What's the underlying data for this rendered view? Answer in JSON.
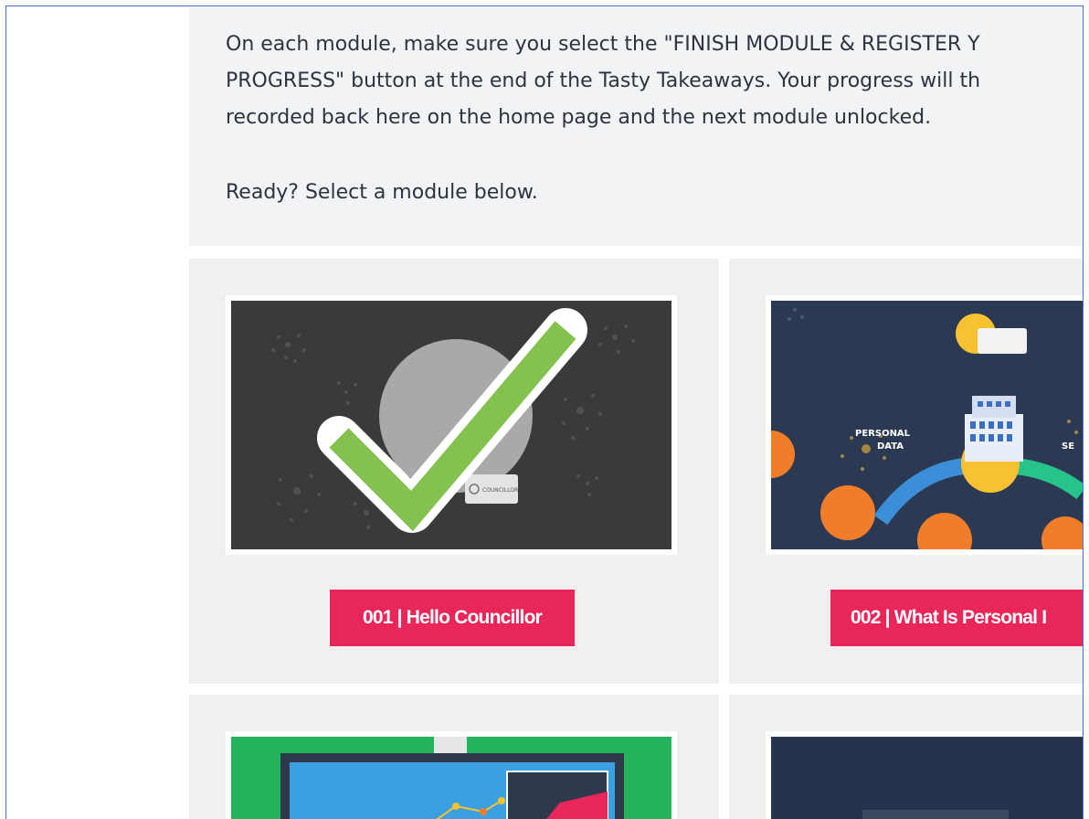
{
  "intro": {
    "paragraph_1": "On each module, make sure you select the \"FINISH MODULE & REGISTER YOUR PROGRESS\" button at the end of the Tasty Takeaways. Your progress will then be recorded back here on the home page and the next module unlocked.",
    "line_1": "On each module, make sure you select the \"FINISH MODULE & REGISTER Y",
    "line_2": "PROGRESS\" button at the end of the Tasty Takeaways. Your progress will th",
    "line_3": "recorded back here on the home page and the next module unlocked.",
    "paragraph_2": "Ready? Select  a module below."
  },
  "modules": [
    {
      "button_label": "001 | Hello Councillor",
      "badge_text": "COUNCILLOR",
      "status": "completed",
      "thumb_bg": "#3a3a3a"
    },
    {
      "button_label": "002 | What Is Personal I",
      "label_personal_data": "PERSONAL\nDATA",
      "label_personal": "PERSONAL",
      "label_data": "DATA",
      "label_partial": "SE",
      "thumb_bg": "#2b3a52"
    },
    {
      "thumb_bg": "#23b35a"
    },
    {
      "thumb_bg": "#24344d"
    }
  ],
  "colors": {
    "accent_button": "#e8265a",
    "intro_bg": "#f2f3f5",
    "card_bg": "#f0f0f0",
    "check_green": "#84c250",
    "frame_border": "#4a72c4"
  }
}
